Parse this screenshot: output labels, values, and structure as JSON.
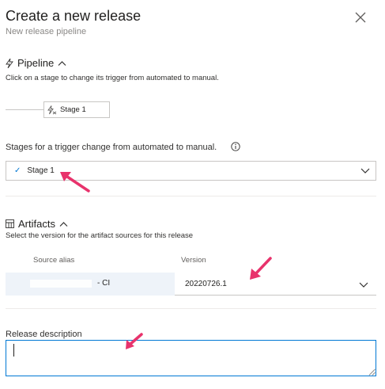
{
  "dialog": {
    "title": "Create a new release",
    "subtitle": "New release pipeline",
    "close_icon": "close-icon"
  },
  "pipeline": {
    "heading": "Pipeline",
    "icon": "lightning-icon",
    "toggle_icon": "chevron-up-icon",
    "help": "Click on a stage to change its trigger from automated to manual.",
    "stage_name": "Stage 1",
    "stage_icon": "stage-trigger-icon"
  },
  "trigger": {
    "label": "Stages for a trigger change from automated to manual.",
    "info_icon": "info-icon",
    "selected": "Stage 1"
  },
  "artifacts": {
    "heading": "Artifacts",
    "icon": "artifact-grid-icon",
    "toggle_icon": "chevron-up-icon",
    "help": "Select the version for the artifact sources for this release",
    "columns": [
      "Source alias",
      "Version"
    ],
    "rows": [
      {
        "alias_suffix": "- CI",
        "version": "20220726.1"
      }
    ]
  },
  "description": {
    "label": "Release description",
    "value": ""
  },
  "colors": {
    "accent": "#0078d4",
    "annotation_arrow": "#e8336c"
  }
}
